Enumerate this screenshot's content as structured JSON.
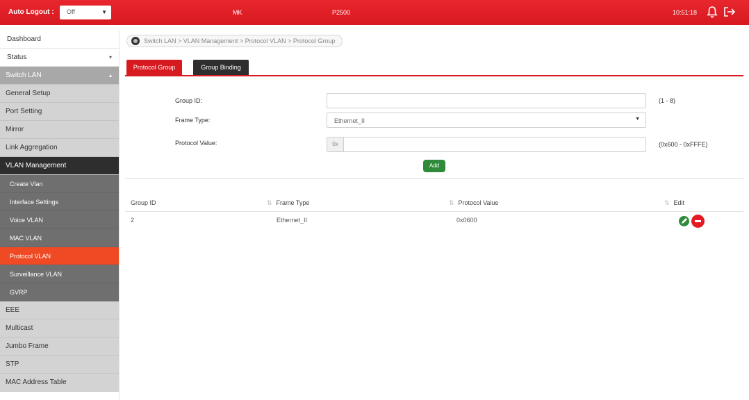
{
  "topbar": {
    "auto_logout_label": "Auto Logout :",
    "auto_logout_value": "Off",
    "model": "MK",
    "device": "P2500",
    "time": "10:51:18"
  },
  "sidebar": {
    "items": [
      {
        "label": "Dashboard"
      },
      {
        "label": "Status"
      },
      {
        "label": "Switch LAN"
      },
      {
        "label": "General Setup"
      },
      {
        "label": "Port Setting"
      },
      {
        "label": "Mirror"
      },
      {
        "label": "Link Aggregation"
      },
      {
        "label": "VLAN Management"
      },
      {
        "label": "Create Vlan"
      },
      {
        "label": "Interface Settings"
      },
      {
        "label": "Voice VLAN"
      },
      {
        "label": "MAC VLAN"
      },
      {
        "label": "Protocol VLAN"
      },
      {
        "label": "Surveillance VLAN"
      },
      {
        "label": "GVRP"
      },
      {
        "label": "EEE"
      },
      {
        "label": "Multicast"
      },
      {
        "label": "Jumbo Frame"
      },
      {
        "label": "STP"
      },
      {
        "label": "MAC Address Table"
      }
    ]
  },
  "breadcrumb": "Switch LAN > VLAN Management > Protocol VLAN > Protocol Group",
  "tabs": [
    {
      "label": "Protocol Group"
    },
    {
      "label": "Group Binding"
    }
  ],
  "form": {
    "group_id_label": "Group ID:",
    "group_id_value": "",
    "group_id_hint": "(1 - 8)",
    "frame_type_label": "Frame Type:",
    "frame_type_value": "Ethernet_II",
    "protocol_value_label": "Protocol Value:",
    "protocol_prefix": "0x",
    "protocol_value": "",
    "protocol_hint": "(0x600 - 0xFFFE)",
    "add_label": "Add"
  },
  "table": {
    "columns": [
      "Group ID",
      "Frame Type",
      "Protocol Value",
      "Edit"
    ],
    "rows": [
      {
        "group_id": "2",
        "frame_type": "Ethernet_II",
        "protocol_value": "0x0600"
      }
    ]
  },
  "colors": {
    "brand_red": "#d71920",
    "active_orange": "#f04a24",
    "edit_green": "#2f8b3a"
  }
}
